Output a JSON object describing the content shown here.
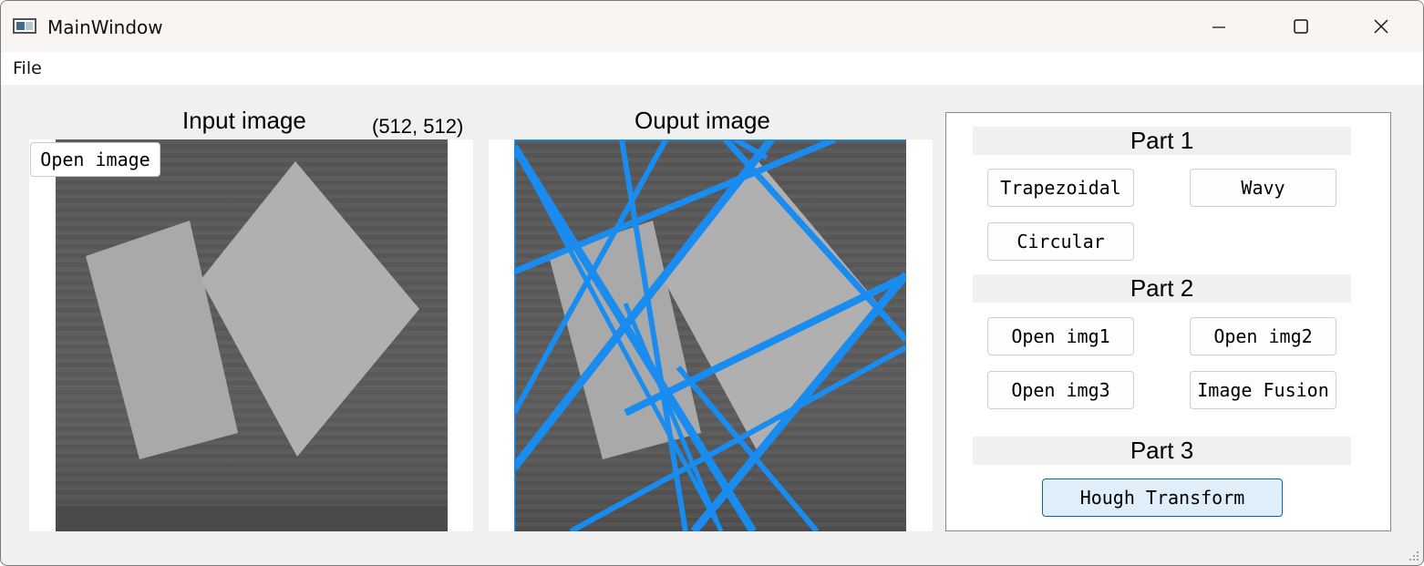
{
  "window": {
    "title": "MainWindow"
  },
  "menu": {
    "file": "File"
  },
  "input": {
    "label": "Input image",
    "size": "(512, 512)",
    "open_button": "Open image"
  },
  "output": {
    "label": "Ouput image"
  },
  "panel": {
    "part1": {
      "label": "Part 1",
      "buttons": [
        "Trapezoidal",
        "Wavy",
        "Circular"
      ]
    },
    "part2": {
      "label": "Part 2",
      "buttons": [
        "Open img1",
        "Open img2",
        "Open img3",
        "Image Fusion"
      ]
    },
    "part3": {
      "label": "Part 3",
      "buttons": [
        "Hough Transform"
      ]
    }
  },
  "colors": {
    "accent": "#0067c0",
    "hough_lines": "#1a8cf0",
    "primary_button_bg": "#e0eef9"
  }
}
